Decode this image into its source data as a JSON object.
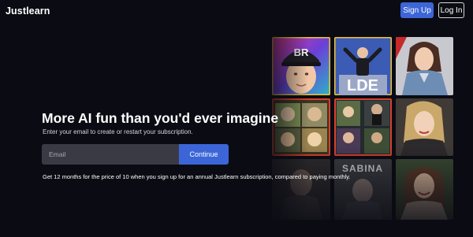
{
  "header": {
    "brand": "Justlearn",
    "signup_label": "Sign Up",
    "login_label": "Log In"
  },
  "hero": {
    "title": "More AI fun than you'd ever imagine",
    "subtitle": "Enter your email to create or restart your subscription.",
    "email_placeholder": "Email",
    "continue_label": "Continue",
    "promo": "Get 12 months for the price of 10 when you sign up for an annual Justlearn subscription, compared to paying monthly."
  },
  "mosaic": {
    "tiles": [
      {
        "name": "tile-cap-portrait",
        "caption": "BR"
      },
      {
        "name": "tile-stage-performer",
        "caption": "LDE"
      },
      {
        "name": "tile-denim-portrait",
        "caption": ""
      },
      {
        "name": "tile-vintage-collage",
        "caption": ""
      },
      {
        "name": "tile-figures-collage",
        "caption": ""
      },
      {
        "name": "tile-blonde-portrait",
        "caption": ""
      },
      {
        "name": "tile-dark-portrait",
        "caption": ""
      },
      {
        "name": "tile-sabina-poster",
        "caption": "SABINA"
      },
      {
        "name": "tile-smiling-portrait",
        "caption": ""
      }
    ]
  },
  "colors": {
    "background": "#0b0b13",
    "accent": "#3c66d8",
    "input": "#3a3a44"
  }
}
